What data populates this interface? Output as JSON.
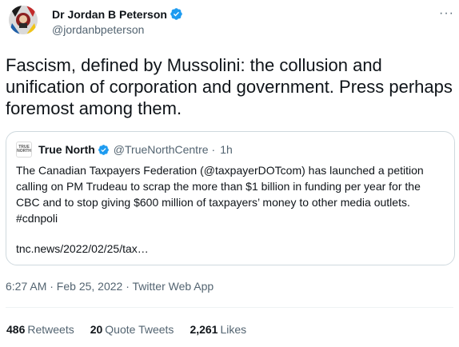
{
  "author": {
    "name": "Dr Jordan B Peterson",
    "handle": "@jordanbpeterson"
  },
  "more_icon": "···",
  "tweet": {
    "text": "Fascism, defined by Mussolini: the collusion and unification of corporation and government. Press perhaps foremost among them."
  },
  "quote": {
    "avatar_text_1": "TRUE",
    "avatar_text_2": "NORTH",
    "name": "True North",
    "handle": "@TrueNorthCentre",
    "time": "1h",
    "separator": "·",
    "body": "The Canadian Taxpayers Federation (@taxpayerDOTcom) has launched a petition calling on PM Trudeau to scrap the more than $1 billion in funding per year for the CBC and to stop giving $600 million of taxpayers’ money to other media outlets. #cdnpoli",
    "link": "tnc.news/2022/02/25/tax…"
  },
  "meta": {
    "timestamp": "6:27 AM · Feb 25, 2022 · Twitter Web App"
  },
  "stats": {
    "retweets_count": "486",
    "retweets_label": "Retweets",
    "quotes_count": "20",
    "quotes_label": "Quote Tweets",
    "likes_count": "2,261",
    "likes_label": "Likes"
  },
  "colors": {
    "verified": "#1d9bf0",
    "text_primary": "#0f1419",
    "text_secondary": "#536471",
    "border": "#cfd9de"
  },
  "icons": {
    "verified": "verified-badge-icon",
    "more": "more-options-icon"
  }
}
